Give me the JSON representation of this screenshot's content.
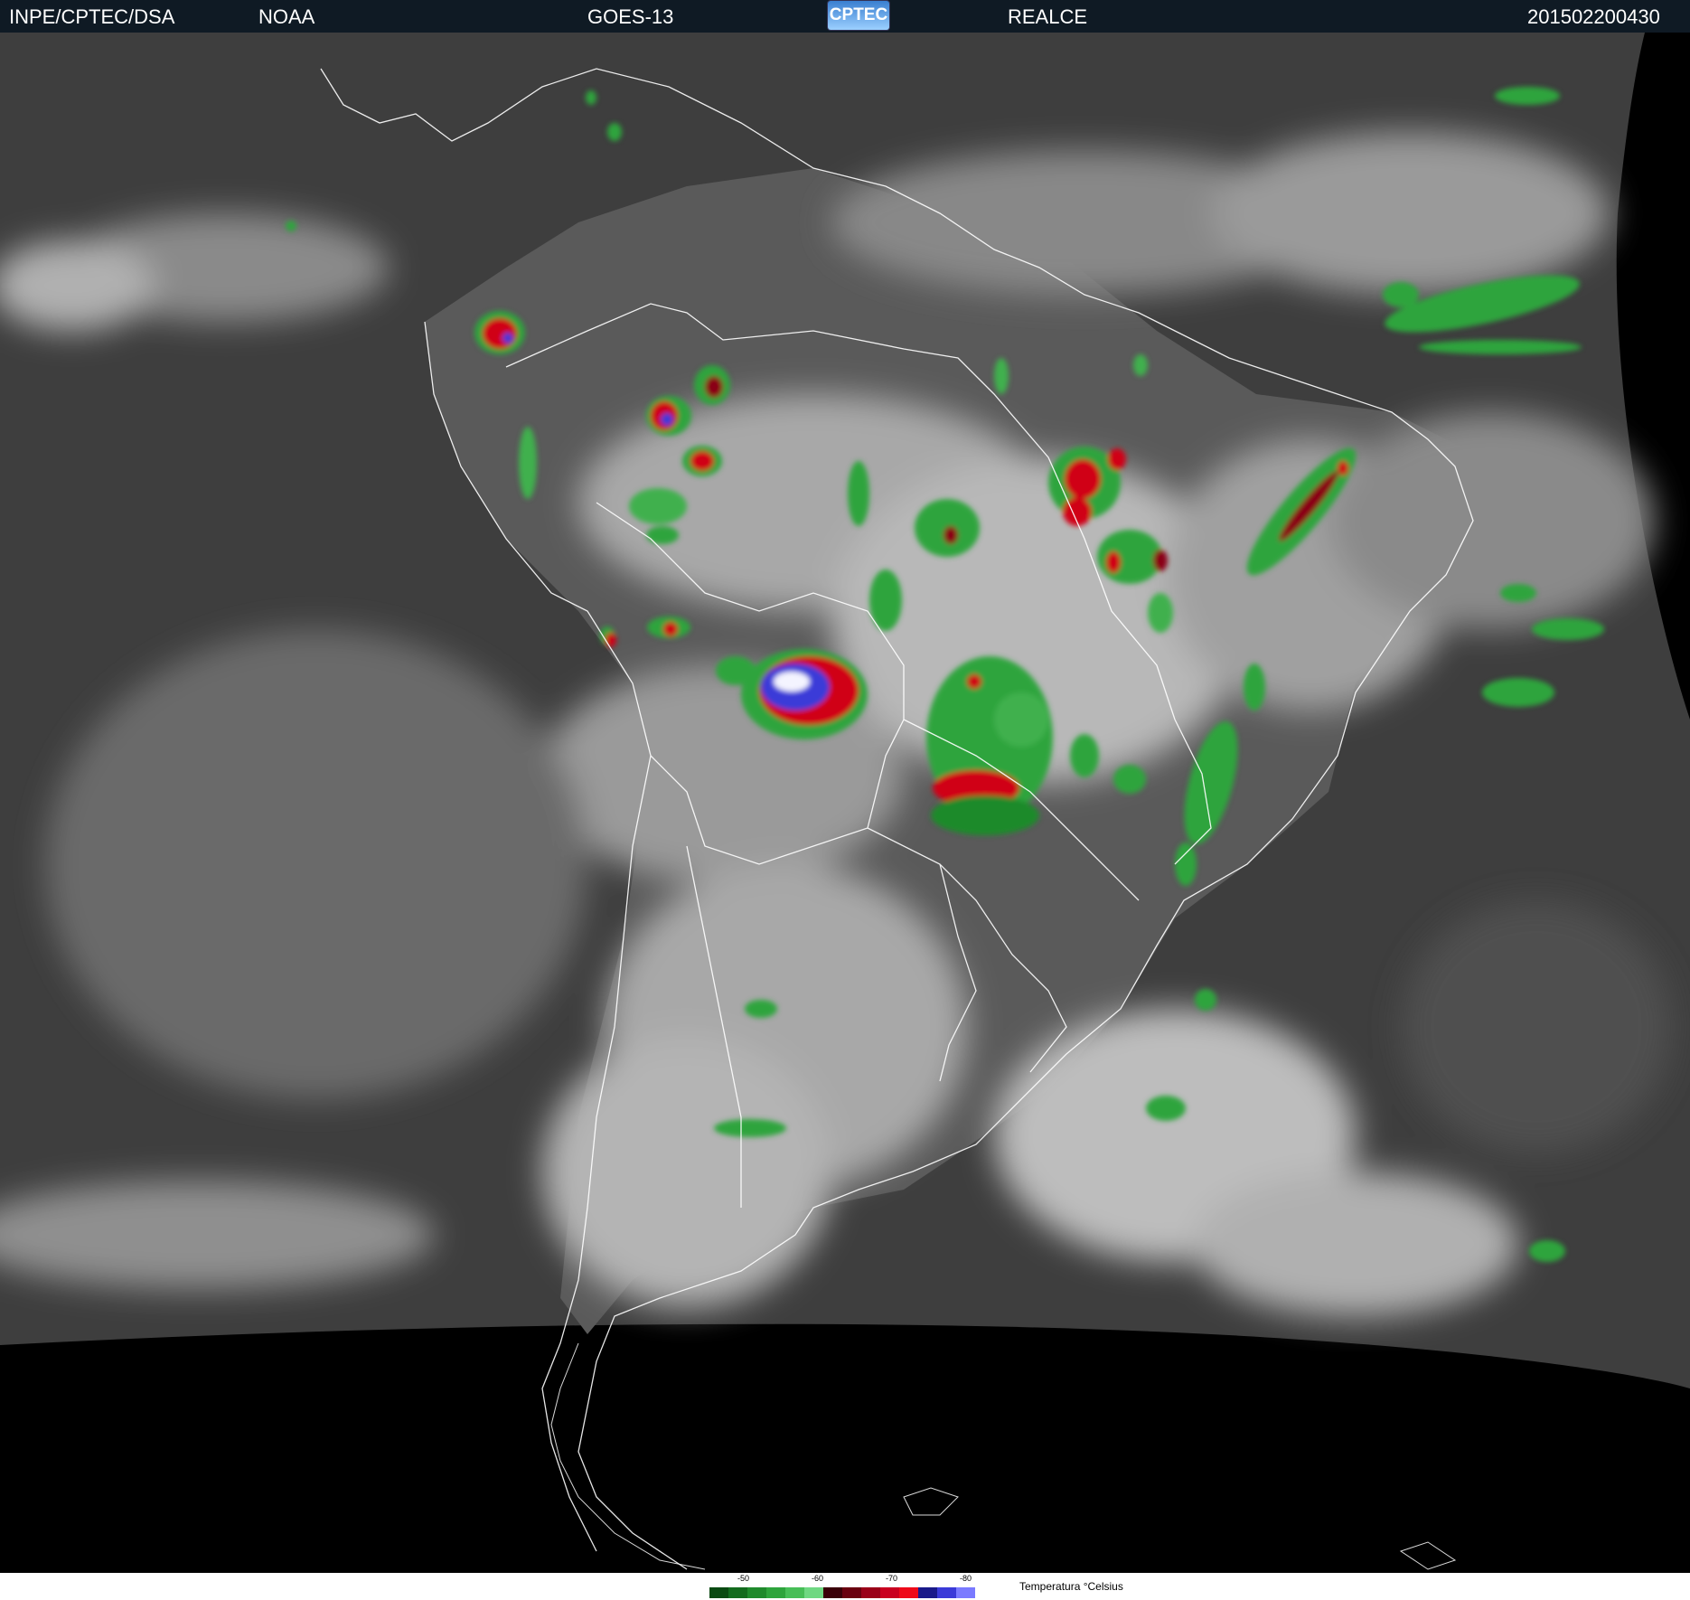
{
  "header": {
    "org": "INPE/CPTEC/DSA",
    "agency": "NOAA",
    "satellite": "GOES-13",
    "logo": "CPTEC",
    "product": "REALCE",
    "timestamp": "201502200430"
  },
  "legend": {
    "title": "Temperatura °Celsius",
    "ticks": [
      "-50",
      "-60",
      "-70",
      "-80"
    ],
    "colors": [
      "#0a4a12",
      "#136b1e",
      "#1f8a2c",
      "#2ea43c",
      "#47be57",
      "#6fd882",
      "#3a0008",
      "#6a000f",
      "#9a0018",
      "#c90020",
      "#ee0a1a",
      "#1a1a8a",
      "#3a3ad8",
      "#7a7aff"
    ]
  },
  "map": {
    "region": "South America",
    "channel": "IR enhanced",
    "background": "#3c3c3c",
    "ocean_tone": "#5c5c5c",
    "cloud_tone": "#c8c8c8",
    "coastline_color": "#ffffff",
    "space_color": "#000000"
  }
}
